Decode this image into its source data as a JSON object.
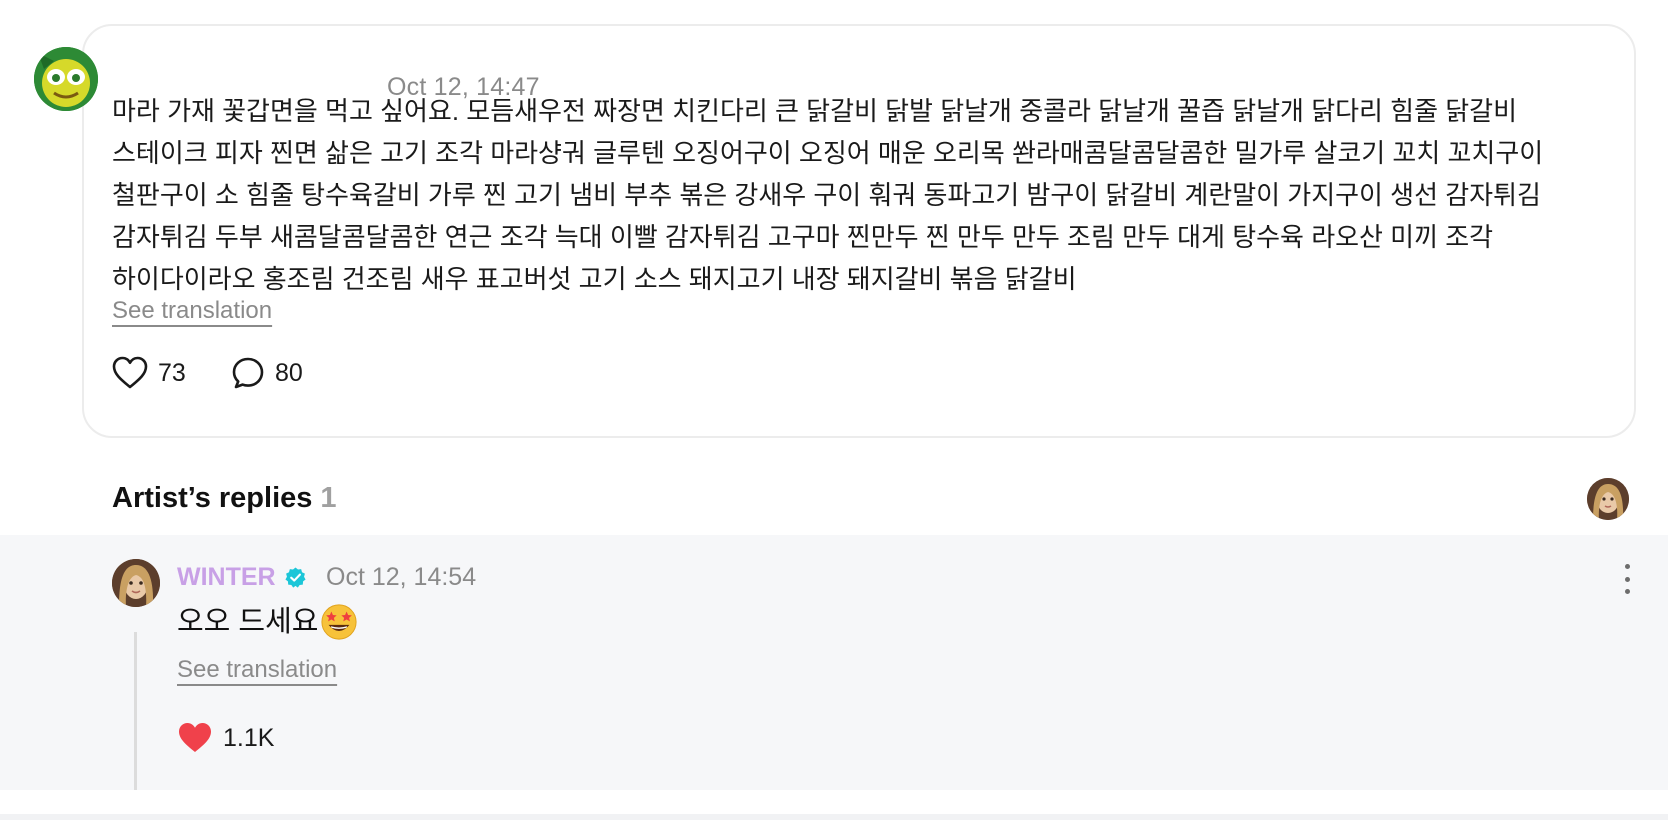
{
  "post": {
    "timestamp": "Oct 12, 14:47",
    "body": "마라 가재 꽃갑면을 먹고 싶어요. 모듬새우전 짜장면 치킨다리 큰 닭갈비 닭발 닭날개 중콜라 닭날개 꿀즙 닭날개 닭다리 힘줄 닭갈비 스테이크 피자 찐면 삶은 고기 조각 마라샹궈 글루텐 오징어구이 오징어 매운 오리목 쏸라매콤달콤달콤한 밀가루 살코기 꼬치 꼬치구이 철판구이 소 힘줄 탕수육갈비 가루 찐 고기 냄비 부추 볶은 강새우 구이 훠궈 동파고기 밤구이 닭갈비 계란말이 가지구이 생선 감자튀김 감자튀김 두부 새콤달콤달콤한 연근 조각 늑대 이빨 감자튀김 고구마 찐만두 찐 만두 만두 조림 만두 대게 탕수육 라오산 미끼 조각 하이다이라오 홍조림 건조림 새우 표고버섯 고기 소스 돼지고기 내장 돼지갈비 볶음 닭갈비",
    "see_translation": "See translation",
    "likes": "73",
    "comments": "80",
    "avatar_icon": "green-character-avatar",
    "like_icon": "heart-outline-icon",
    "comment_icon": "speech-bubble-icon"
  },
  "artist_replies": {
    "title": "Artist’s replies",
    "count": "1",
    "header_avatar_icon": "artist-avatar"
  },
  "reply": {
    "author": "WINTER",
    "verified_icon": "verified-badge-icon",
    "timestamp": "Oct 12, 14:54",
    "text": "오오 드세요",
    "emoji": "star-struck-emoji",
    "see_translation": "See translation",
    "likes": "1.1K",
    "like_icon": "heart-filled-icon"
  },
  "colors": {
    "artist_name": "#c8a0e6",
    "verified_badge": "#1cc6d8",
    "liked_heart": "#f0414b",
    "muted_text": "#8a8a8a",
    "card_border": "#ececec",
    "reply_panel_bg": "#f6f7f9"
  }
}
